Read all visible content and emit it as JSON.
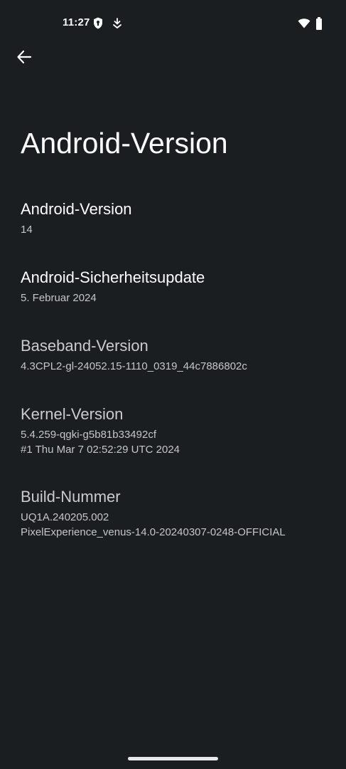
{
  "status_bar": {
    "time": "11:27",
    "icons": [
      "shield-icon",
      "download-icon",
      "wifi-icon",
      "battery-icon"
    ]
  },
  "header": {
    "back_icon": "arrow-back-icon",
    "title": "Android-Version"
  },
  "items": [
    {
      "title": "Android-Version",
      "summary": [
        "14"
      ]
    },
    {
      "title": "Android-Sicherheitsupdate",
      "summary": [
        "5. Februar 2024"
      ]
    },
    {
      "title": "Baseband-Version",
      "summary": [
        "4.3CPL2-gl-24052.15-1110_0319_44c7886802c"
      ]
    },
    {
      "title": "Kernel-Version",
      "summary": [
        "5.4.259-qgki-g5b81b33492cf",
        "#1 Thu Mar 7 02:52:29 UTC 2024"
      ]
    },
    {
      "title": "Build-Nummer",
      "summary": [
        "UQ1A.240205.002",
        "PixelExperience_venus-14.0-20240307-0248-OFFICIAL"
      ]
    }
  ],
  "colors": {
    "background": "#1b1e21",
    "title_text": "#ffffff",
    "summary_text": "#c4c6c9"
  }
}
